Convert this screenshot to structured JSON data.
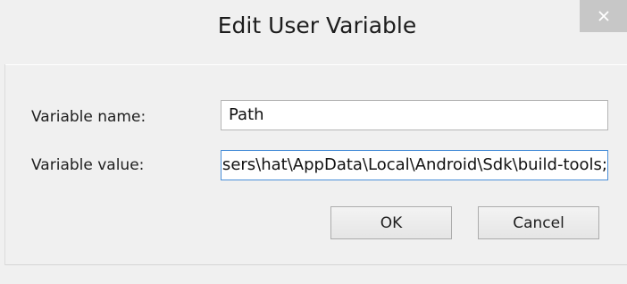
{
  "window": {
    "title": "Edit User Variable",
    "close_icon": "close-icon"
  },
  "form": {
    "name_label": "Variable name:",
    "name_value": "Path",
    "value_label": "Variable value:",
    "value_value": "C:\\Users\\hat\\AppData\\Local\\Android\\Sdk\\build-tools;"
  },
  "buttons": {
    "ok_label": "OK",
    "cancel_label": "Cancel"
  },
  "colors": {
    "background": "#f0f0f0",
    "close_button": "#c7c7c7",
    "focused_border": "#4a8fd8"
  }
}
